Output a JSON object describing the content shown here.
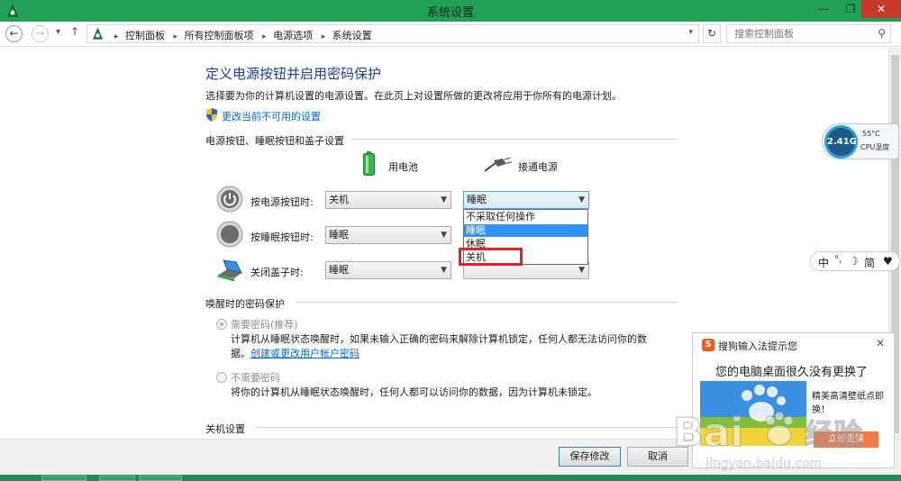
{
  "window": {
    "title": "系统设置",
    "min": "—",
    "max": "❐",
    "close": "✕"
  },
  "nav": {
    "back": "←",
    "forward": "→",
    "history": "▾",
    "up": "↑"
  },
  "address": {
    "crumbs": [
      "控制面板",
      "所有控制面板项",
      "电源选项",
      "系统设置"
    ],
    "separator": "▸",
    "refresh": "↻",
    "search_placeholder": "搜索控制面板",
    "search_icon": "⚲"
  },
  "page": {
    "heading": "定义电源按钮并启用密码保护",
    "intro": "选择要为你的计算机设置的电源设置。在此页上对设置所做的更改将应用于你所有的电源计划。",
    "change_link": "更改当前不可用的设置"
  },
  "buttons_section": {
    "title": "电源按钮、睡眠按钮和盖子设置",
    "col_battery": "用电池",
    "col_plugged": "接通电源",
    "rows": [
      {
        "label": "按电源按钮时:",
        "battery": "关机",
        "plugged": "睡眠"
      },
      {
        "label": "按睡眠按钮时:",
        "battery": "睡眠",
        "plugged": ""
      },
      {
        "label": "关闭盖子时:",
        "battery": "睡眠",
        "plugged": ""
      }
    ],
    "dropdown_options": [
      "不采取任何操作",
      "睡眠",
      "休眠",
      "关机"
    ],
    "dropdown_selected": "睡眠",
    "highlighted_option": "关机"
  },
  "password_section": {
    "title": "唤醒时的密码保护",
    "opt1_label": "需要密码(推荐)",
    "opt1_text1": "计算机从睡眠状态唤醒时，如果未输入正确的密码来解除计算机锁定，任何人都无法访问你的数",
    "opt1_text2": "据。",
    "opt1_link": "创建或更改用户帐户密码",
    "opt2_label": "不需要密码",
    "opt2_text": "将你的计算机从睡眠状态唤醒时，任何人都可以访问你的数据，因为计算机未锁定。"
  },
  "shutdown_section": {
    "title": "关机设置"
  },
  "footer": {
    "save": "保存修改",
    "cancel": "取消"
  },
  "cpu_gadget": {
    "freq": "2.41G",
    "temp": "55°C",
    "label": "CPU温度"
  },
  "ime_bar": {
    "items": [
      "中",
      "°,",
      "☽",
      "简",
      "♥"
    ]
  },
  "popup": {
    "title": "搜狗输入法提示您",
    "close": "✕",
    "logo": "S",
    "headline": "您的电脑桌面很久没有更换了",
    "desc": "精美高清壁纸点即换！",
    "button": "立即更换"
  },
  "watermark": {
    "text": "Baidu 经验",
    "sub": "jingyan.baidu.com"
  },
  "colors": {
    "titlebar": "#21a058",
    "heading": "#1e3f9a",
    "link": "#0066cc",
    "highlight": "#3390ff",
    "redbox": "#e3212b"
  }
}
